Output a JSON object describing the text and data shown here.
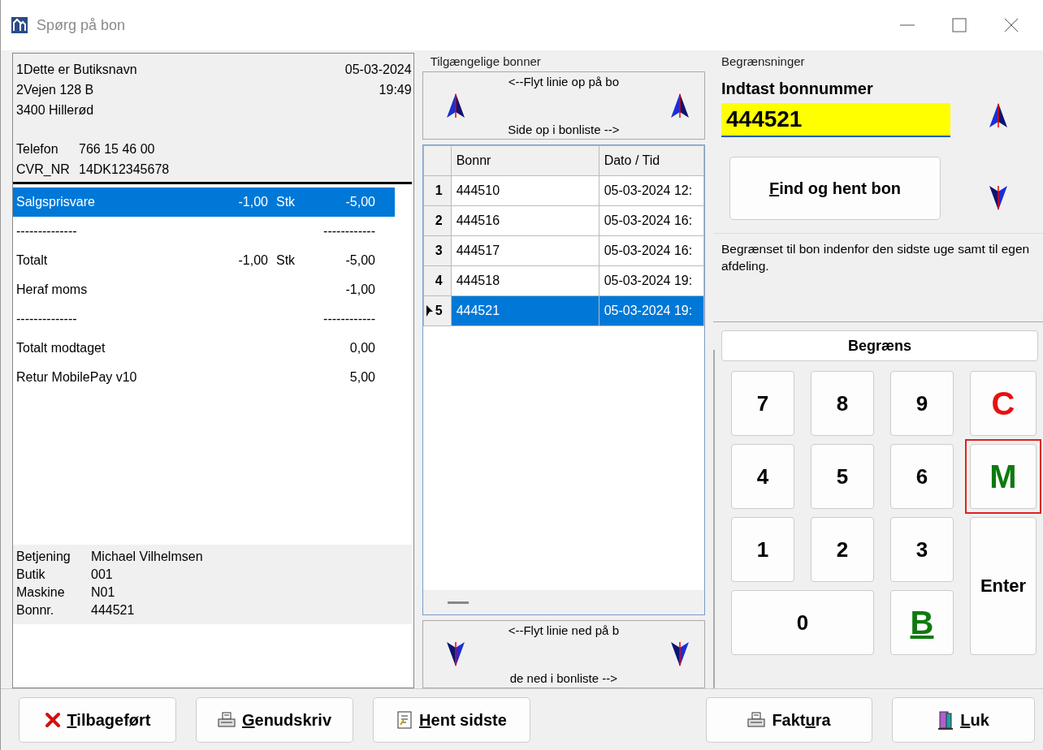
{
  "window": {
    "title": "Spørg på bon"
  },
  "receipt": {
    "header_left": [
      "1Dette er Butiksnavn",
      "2Vejen 128 B",
      "3400 Hillerød"
    ],
    "header_right": [
      "05-03-2024",
      "19:49"
    ],
    "header_info": [
      {
        "label": "Telefon",
        "value": "766 15 46 00"
      },
      {
        "label": "CVR_NR",
        "value": "14DK12345678"
      }
    ],
    "lines": [
      {
        "label": "Salgsprisvare",
        "qty": "-1,00",
        "unit": "Stk",
        "amount": "-5,00",
        "selected": true
      },
      {
        "label": "--------------",
        "amount": "------------",
        "selected": false
      },
      {
        "label": "Totalt",
        "qty": "-1,00",
        "unit": "Stk",
        "amount": "-5,00",
        "selected": false
      },
      {
        "label": "Heraf moms",
        "amount": "-1,00",
        "selected": false
      },
      {
        "label": "--------------",
        "amount": "------------",
        "selected": false
      },
      {
        "label": "Totalt modtaget",
        "amount": "0,00",
        "selected": false
      },
      {
        "label": "Retur MobilePay v10",
        "amount": "5,00",
        "selected": false
      }
    ],
    "footer": [
      {
        "label": "Betjening",
        "value": "Michael Vilhelmsen"
      },
      {
        "label": "Butik",
        "value": "001"
      },
      {
        "label": "Maskine",
        "value": "N01"
      },
      {
        "label": "Bonnr.",
        "value": "444521"
      }
    ]
  },
  "available": {
    "title": "Tilgængelige bonner",
    "up_button": {
      "top": "<--Flyt linie op på bo",
      "bottom": "Side op i bonliste -->"
    },
    "columns": [
      "Bonnr",
      "Dato / Tid"
    ],
    "rows": [
      {
        "index": "1",
        "bonnr": "444510",
        "datetime": "05-03-2024 12:",
        "selected": false
      },
      {
        "index": "2",
        "bonnr": "444516",
        "datetime": "05-03-2024 16:",
        "selected": false
      },
      {
        "index": "3",
        "bonnr": "444517",
        "datetime": "05-03-2024 16:",
        "selected": false
      },
      {
        "index": "4",
        "bonnr": "444518",
        "datetime": "05-03-2024 19:",
        "selected": false
      },
      {
        "index": "5",
        "bonnr": "444521",
        "datetime": "05-03-2024 19:",
        "selected": true
      }
    ],
    "down_button": {
      "top": "<--Flyt linie ned på b",
      "bottom": "de ned i bonliste -->"
    }
  },
  "limits": {
    "title": "Begrænsninger",
    "input_label": "Indtast bonnummer",
    "input_value": "444521",
    "find_button": {
      "label": "Find og hent bon"
    },
    "note": "Begrænset til bon indenfor den sidste uge samt til egen afdeling.",
    "limit_button": {
      "label": "Begræns"
    },
    "keys": [
      {
        "label": "7",
        "kind": "digit",
        "highlighted": false
      },
      {
        "label": "8",
        "kind": "digit",
        "highlighted": false
      },
      {
        "label": "9",
        "kind": "digit",
        "highlighted": false
      },
      {
        "label": "C",
        "kind": "clear",
        "highlighted": false
      },
      {
        "label": "4",
        "kind": "digit",
        "highlighted": false
      },
      {
        "label": "5",
        "kind": "digit",
        "highlighted": false
      },
      {
        "label": "6",
        "kind": "digit",
        "highlighted": false
      },
      {
        "label": "M",
        "kind": "memory",
        "highlighted": true
      },
      {
        "label": "1",
        "kind": "digit",
        "highlighted": false
      },
      {
        "label": "2",
        "kind": "digit",
        "highlighted": false
      },
      {
        "label": "3",
        "kind": "digit",
        "highlighted": false
      },
      {
        "label": "Enter",
        "kind": "enter",
        "highlighted": false
      },
      {
        "label": "0",
        "kind": "zero",
        "highlighted": false
      },
      {
        "label": "B",
        "kind": "back",
        "highlighted": false
      }
    ]
  },
  "bottom_buttons": [
    {
      "label": "Tilbageført"
    },
    {
      "label": "Genudskriv"
    },
    {
      "label": "Hent sidste"
    },
    {
      "label": "Faktura"
    },
    {
      "label": "Luk"
    }
  ]
}
